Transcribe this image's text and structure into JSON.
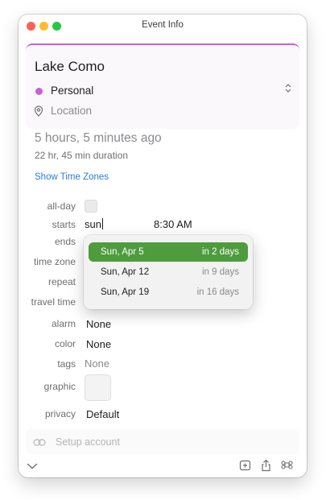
{
  "window": {
    "title": "Event Info"
  },
  "event": {
    "title": "Lake Como",
    "calendar": {
      "name": "Personal",
      "color": "#c95fd9"
    },
    "location_placeholder": "Location"
  },
  "time_info": {
    "relative": "5 hours, 5 minutes ago",
    "duration": "22 hr, 45 min duration",
    "show_time_zones": "Show Time Zones"
  },
  "fields": {
    "all_day": {
      "label": "all-day",
      "checked": false
    },
    "starts": {
      "label": "starts",
      "date_value": "sun",
      "time_value": "8:30 AM"
    },
    "ends": {
      "label": "ends"
    },
    "time_zone": {
      "label": "time zone"
    },
    "repeat": {
      "label": "repeat"
    },
    "travel_time": {
      "label": "travel time"
    },
    "alarm": {
      "label": "alarm",
      "value": "None"
    },
    "color": {
      "label": "color",
      "value": "None"
    },
    "tags": {
      "label": "tags",
      "value": "None"
    },
    "graphic": {
      "label": "graphic"
    },
    "privacy": {
      "label": "privacy",
      "value": "Default"
    }
  },
  "date_suggestions": [
    {
      "date": "Sun, Apr 5",
      "relative": "in 2 days",
      "selected": true
    },
    {
      "date": "Sun, Apr 12",
      "relative": "in 9 days",
      "selected": false
    },
    {
      "date": "Sun, Apr 19",
      "relative": "in 16 days",
      "selected": false
    }
  ],
  "setup": {
    "label": "Setup account",
    "icon": "link-icon"
  },
  "bottom_bar": {
    "icons": [
      "chevron-down-icon",
      "add-to-calendar-icon",
      "share-icon",
      "command-icon"
    ]
  },
  "colors": {
    "accent": "#c95fd9",
    "selection": "#4e9c3d",
    "link": "#2e7bd6"
  }
}
